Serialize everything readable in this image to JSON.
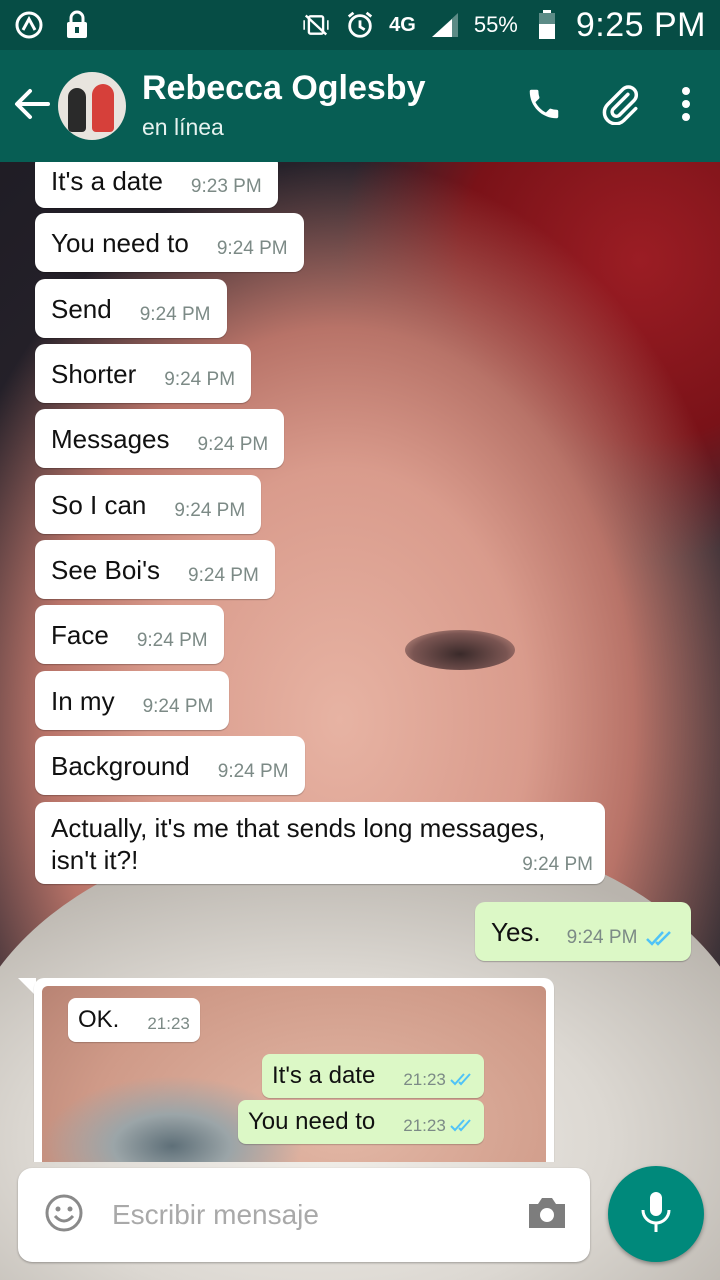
{
  "status_bar": {
    "network": "4G",
    "battery": "55%",
    "time": "9:25 PM",
    "icons": [
      "whatsapp-icon",
      "lock-icon",
      "mute-vibrate-icon",
      "alarm-icon",
      "signal-icon",
      "battery-icon"
    ]
  },
  "header": {
    "contact_name": "Rebecca Oglesby",
    "contact_status": "en línea",
    "icons": [
      "back-arrow-icon",
      "phone-icon",
      "paperclip-icon",
      "more-vert-icon"
    ]
  },
  "messages": [
    {
      "text": "It's a date",
      "time": "9:23 PM",
      "direction": "in"
    },
    {
      "text": "You need to",
      "time": "9:24 PM",
      "direction": "in"
    },
    {
      "text": "Send",
      "time": "9:24 PM",
      "direction": "in"
    },
    {
      "text": "Shorter",
      "time": "9:24 PM",
      "direction": "in"
    },
    {
      "text": "Messages",
      "time": "9:24 PM",
      "direction": "in"
    },
    {
      "text": "So I can",
      "time": "9:24 PM",
      "direction": "in"
    },
    {
      "text": "See Boi's",
      "time": "9:24 PM",
      "direction": "in"
    },
    {
      "text": "Face",
      "time": "9:24 PM",
      "direction": "in"
    },
    {
      "text": "In my",
      "time": "9:24 PM",
      "direction": "in"
    },
    {
      "text": "Background",
      "time": "9:24 PM",
      "direction": "in"
    },
    {
      "text": "Actually, it's me that sends long messages, isn't it?!",
      "time": "9:24 PM",
      "direction": "in"
    },
    {
      "text": "Yes.",
      "time": "9:24 PM",
      "direction": "out",
      "read": true
    }
  ],
  "image_message": {
    "inner_messages": [
      {
        "text": "OK.",
        "time": "21:23",
        "direction": "in"
      },
      {
        "text": "It's a date",
        "time": "21:23",
        "direction": "out"
      },
      {
        "text": "You need to",
        "time": "21:23",
        "direction": "out"
      }
    ]
  },
  "composer": {
    "placeholder": "Escribir mensaje",
    "icons": [
      "emoji-icon",
      "camera-icon",
      "microphone-icon"
    ]
  },
  "colors": {
    "status_bar": "#064d45",
    "header": "#075e54",
    "outgoing_bubble": "#dcf8c6",
    "incoming_bubble": "#ffffff",
    "read_ticks": "#4fc3f7",
    "mic_button": "#00897b"
  }
}
